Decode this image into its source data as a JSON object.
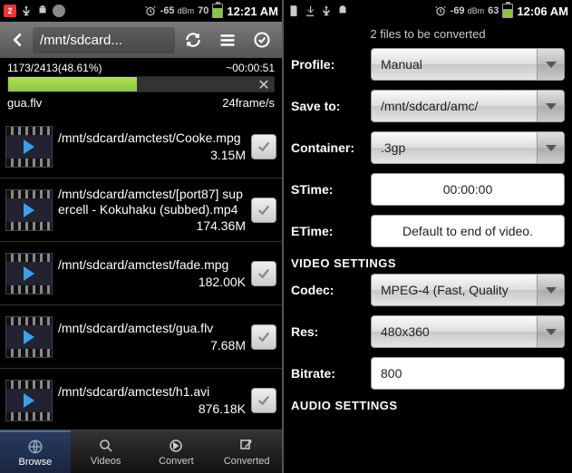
{
  "left": {
    "status": {
      "notif_count": "2",
      "signal_dbm": "-65",
      "signal_unit": "dBm",
      "battery_pct": "70",
      "time": "12:21 AM"
    },
    "path": "/mnt/sdcard...",
    "progress": {
      "counter": "1173/2413(48.61%)",
      "eta": "~00:00:51",
      "percent": 48.61,
      "filename": "gua.flv",
      "rate": "24frame/s"
    },
    "files": [
      {
        "path": "/mnt/sdcard/amctest/Cooke.mpg",
        "size": "3.15M"
      },
      {
        "path": "/mnt/sdcard/amctest/[port87] supercell - Kokuhaku (subbed).mp4",
        "size": "174.36M"
      },
      {
        "path": "/mnt/sdcard/amctest/fade.mpg",
        "size": "182.00K"
      },
      {
        "path": "/mnt/sdcard/amctest/gua.flv",
        "size": "7.68M"
      },
      {
        "path": "/mnt/sdcard/amctest/h1.avi",
        "size": "876.18K"
      }
    ],
    "tabs": {
      "browse": "Browse",
      "videos": "Videos",
      "convert": "Convert",
      "converted": "Converted"
    }
  },
  "right": {
    "status": {
      "signal_dbm": "-69",
      "signal_unit": "dBm",
      "battery_pct": "63",
      "time": "12:06 AM"
    },
    "title": "2  files to be converted",
    "fields": {
      "profile_label": "Profile:",
      "profile_value": "Manual",
      "saveto_label": "Save to:",
      "saveto_value": "/mnt/sdcard/amc/",
      "container_label": "Container:",
      "container_value": ".3gp",
      "stime_label": "STime:",
      "stime_value": "00:00:00",
      "etime_label": "ETime:",
      "etime_value": "Default to end of video.",
      "video_section": "VIDEO SETTINGS",
      "codec_label": "Codec:",
      "codec_value": "MPEG-4 (Fast, Quality",
      "res_label": "Res:",
      "res_value": "480x360",
      "bitrate_label": "Bitrate:",
      "bitrate_value": "800",
      "audio_section": "AUDIO SETTINGS"
    }
  }
}
